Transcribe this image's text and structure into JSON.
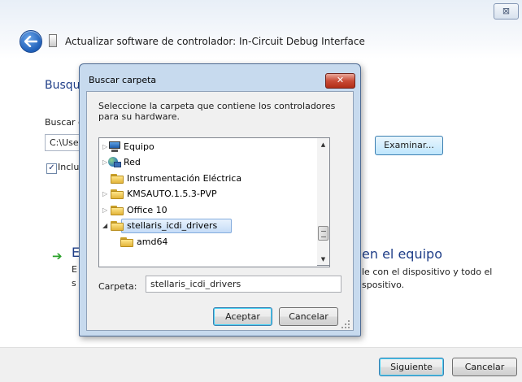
{
  "wizard": {
    "title": "Actualizar software de controlador: In-Circuit Debug Interface",
    "close_glyph": "⊠",
    "heading_fragment": "Busqu",
    "search_label_fragment": "Buscar c",
    "path_fragment": "C:\\Use",
    "include_fragment": "Inclu",
    "examinar_label": "Examinar...",
    "option_title_fragment": "en el equipo",
    "option_line1_fragment": "le con el dispositivo y todo el",
    "option_line2_fragment": "spositivo.",
    "option_left_E": "E",
    "option_left_line1": "E",
    "option_left_line2": "s",
    "next_label": "Siguiente",
    "cancel_label": "Cancelar"
  },
  "browse": {
    "title": "Buscar carpeta",
    "close_glyph": "✕",
    "description": "Seleccione la carpeta que contiene los controladores para su hardware.",
    "tree": [
      {
        "label": "Equipo",
        "icon": "computer-icon",
        "expander": "collapsed",
        "indent": 0
      },
      {
        "label": "Red",
        "icon": "network-icon",
        "expander": "collapsed",
        "indent": 0
      },
      {
        "label": "Instrumentación Eléctrica",
        "icon": "folder-icon",
        "expander": "none",
        "indent": 0
      },
      {
        "label": "KMSAUTO.1.5.3-PVP",
        "icon": "folder-icon",
        "expander": "collapsed",
        "indent": 0
      },
      {
        "label": "Office 10",
        "icon": "folder-icon",
        "expander": "collapsed",
        "indent": 0
      },
      {
        "label": "stellaris_icdi_drivers",
        "icon": "folder-icon",
        "expander": "expanded",
        "indent": 0,
        "selected": true
      },
      {
        "label": "amd64",
        "icon": "folder-icon",
        "expander": "none",
        "indent": 1
      }
    ],
    "folder_label": "Carpeta:",
    "folder_value": "stellaris_icdi_drivers",
    "ok_label": "Aceptar",
    "cancel_label": "Cancelar"
  },
  "colors": {
    "accent": "#1f3e88",
    "selection": "#c5dcf7",
    "close_red": "#c94b36"
  }
}
